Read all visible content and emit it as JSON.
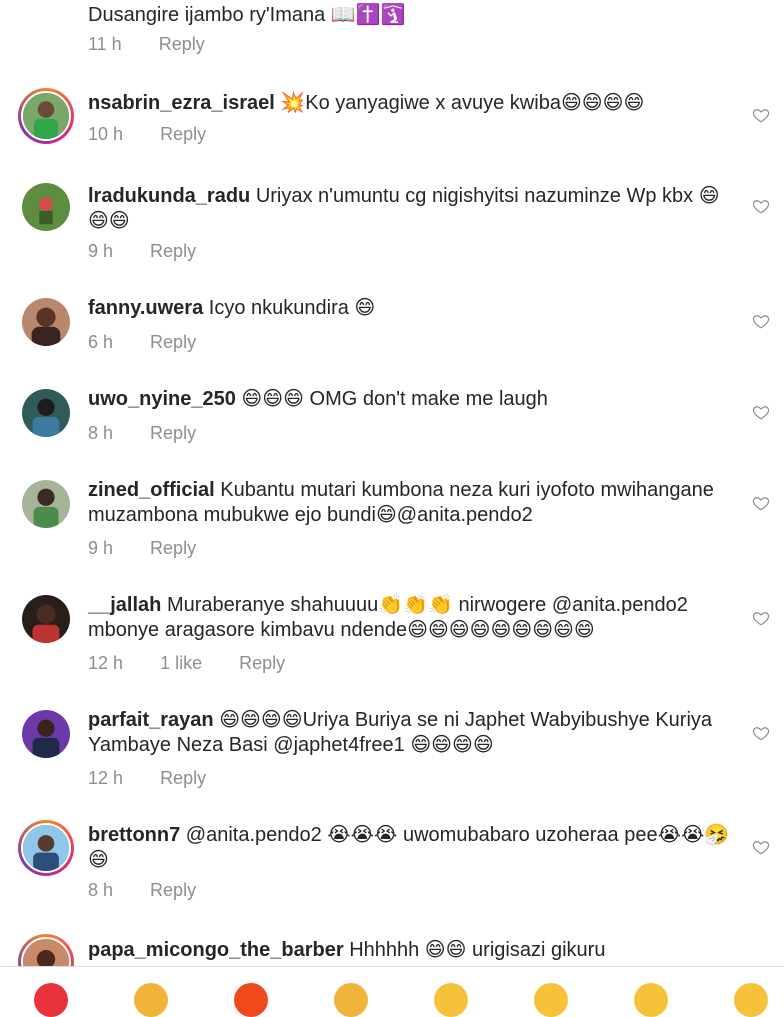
{
  "comments": [
    {
      "username": "",
      "text": "Dusangire ijambo ry'Imana 📖✝️🛐",
      "time": "11 h",
      "likes": "",
      "reply": "Reply"
    },
    {
      "username": "nsabrin_ezra_israel",
      "text": "💥Ko yanyagiwe x avuye kwiba😄😄😄😄",
      "time": "10 h",
      "likes": "",
      "reply": "Reply"
    },
    {
      "username": "lradukunda_radu",
      "text": "Uriyax n'umuntu cg nigishyitsi nazuminze Wp kbx 😄😄😄",
      "time": "9 h",
      "likes": "",
      "reply": "Reply"
    },
    {
      "username": "fanny.uwera",
      "text": "Icyo nkukundira 😄",
      "time": "6 h",
      "likes": "",
      "reply": "Reply"
    },
    {
      "username": "uwo_nyine_250",
      "text": "😄😄😄 OMG don't make me laugh",
      "time": "8 h",
      "likes": "",
      "reply": "Reply"
    },
    {
      "username": "zined_official",
      "text": "Kubantu mutari kumbona neza kuri iyofoto mwihangane muzambona mubukwe ejo bundi😄@anita.pendo2",
      "time": "9 h",
      "likes": "",
      "reply": "Reply"
    },
    {
      "username": "__jallah",
      "text": "Muraberanye shahuuuu👏👏👏 nirwogere @anita.pendo2 mbonye aragasore kimbavu ndende😄😄😄😄😄😄😄😄😄",
      "time": "12 h",
      "likes": "1 like",
      "reply": "Reply"
    },
    {
      "username": "parfait_rayan",
      "text": "😄😄😄😄Uriya Buriya se ni Japhet Wabyibushye Kuriya Yambaye Neza Basi @japhet4free1 😄😄😄😄",
      "time": "12 h",
      "likes": "",
      "reply": "Reply"
    },
    {
      "username": "brettonn7",
      "text": "@anita.pendo2 😭😭😭 uwomubabaro uzoheraa pee😭😭🤧😄",
      "time": "8 h",
      "likes": "",
      "reply": "Reply"
    },
    {
      "username": "papa_micongo_the_barber",
      "text": "Hhhhhh 😄😄 urigisazi gikuru",
      "time": "",
      "likes": "",
      "reply": ""
    }
  ],
  "colors": {
    "username": "#262626",
    "meta": "#8e8e8e",
    "mention": "#2a4b6e"
  }
}
